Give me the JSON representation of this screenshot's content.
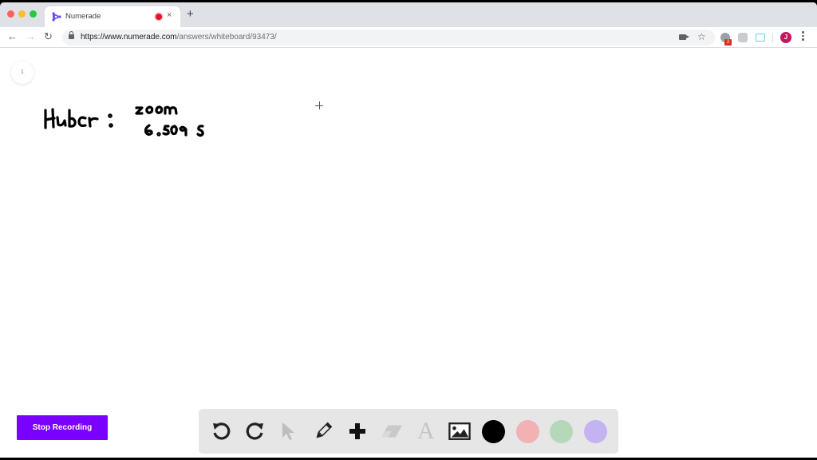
{
  "browser": {
    "tab": {
      "title": "Numerade",
      "favicon": "numerade-logo-icon",
      "recording_indicator": "record-dot-icon",
      "close_label": "×"
    },
    "new_tab_label": "+",
    "nav": {
      "back": "←",
      "forward": "→",
      "reload": "↻"
    },
    "url": {
      "host": "https://www.numerade.com",
      "path": "/answers/whiteboard/93473/"
    },
    "omnibox_icons": [
      "camera-icon",
      "star-icon"
    ],
    "extensions": [
      {
        "name": "ext-privacy-icon",
        "badge": "2"
      },
      {
        "name": "ext-k-icon"
      },
      {
        "name": "ext-screen-icon"
      }
    ],
    "profile": {
      "initial": "J",
      "color": "#c2185b"
    },
    "menu": "more-vert-icon"
  },
  "whiteboard": {
    "page_number": "1",
    "handwriting": {
      "label": "Huber:",
      "line1": "200m",
      "line2": "6.509 s"
    },
    "stop_recording_label": "Stop Recording",
    "tools": [
      {
        "name": "undo",
        "icon": "undo-icon",
        "enabled": true
      },
      {
        "name": "redo",
        "icon": "redo-icon",
        "enabled": true
      },
      {
        "name": "select",
        "icon": "pointer-icon",
        "enabled": false
      },
      {
        "name": "pen",
        "icon": "pencil-icon",
        "enabled": true
      },
      {
        "name": "add",
        "icon": "plus-icon",
        "enabled": true
      },
      {
        "name": "eraser",
        "icon": "eraser-icon",
        "enabled": false
      },
      {
        "name": "text",
        "icon": "text-icon",
        "label": "A",
        "enabled": false
      },
      {
        "name": "image",
        "icon": "image-icon",
        "enabled": true
      }
    ],
    "colors": [
      {
        "name": "black",
        "hex": "#000000",
        "selected": true
      },
      {
        "name": "pink",
        "hex": "#f2b1b3"
      },
      {
        "name": "green",
        "hex": "#b5d9b8"
      },
      {
        "name": "purple",
        "hex": "#c3b3f0"
      }
    ],
    "accent_color": "#7a00ff"
  }
}
